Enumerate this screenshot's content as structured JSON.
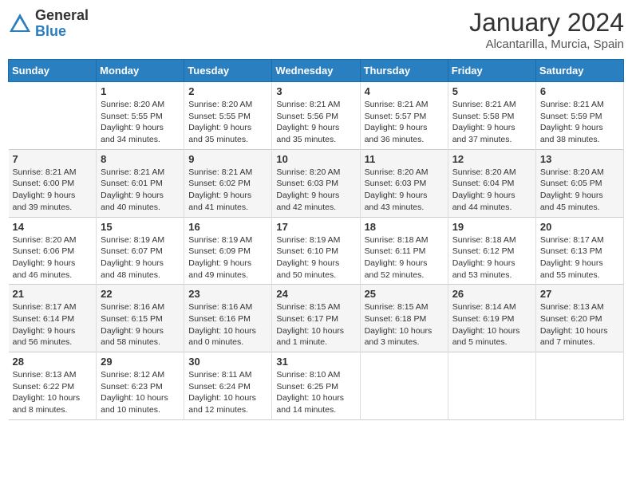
{
  "header": {
    "logo_general": "General",
    "logo_blue": "Blue",
    "month_title": "January 2024",
    "subtitle": "Alcantarilla, Murcia, Spain"
  },
  "days_of_week": [
    "Sunday",
    "Monday",
    "Tuesday",
    "Wednesday",
    "Thursday",
    "Friday",
    "Saturday"
  ],
  "weeks": [
    [
      {
        "day": "",
        "info": ""
      },
      {
        "day": "1",
        "info": "Sunrise: 8:20 AM\nSunset: 5:55 PM\nDaylight: 9 hours\nand 34 minutes."
      },
      {
        "day": "2",
        "info": "Sunrise: 8:20 AM\nSunset: 5:55 PM\nDaylight: 9 hours\nand 35 minutes."
      },
      {
        "day": "3",
        "info": "Sunrise: 8:21 AM\nSunset: 5:56 PM\nDaylight: 9 hours\nand 35 minutes."
      },
      {
        "day": "4",
        "info": "Sunrise: 8:21 AM\nSunset: 5:57 PM\nDaylight: 9 hours\nand 36 minutes."
      },
      {
        "day": "5",
        "info": "Sunrise: 8:21 AM\nSunset: 5:58 PM\nDaylight: 9 hours\nand 37 minutes."
      },
      {
        "day": "6",
        "info": "Sunrise: 8:21 AM\nSunset: 5:59 PM\nDaylight: 9 hours\nand 38 minutes."
      }
    ],
    [
      {
        "day": "7",
        "info": "Sunrise: 8:21 AM\nSunset: 6:00 PM\nDaylight: 9 hours\nand 39 minutes."
      },
      {
        "day": "8",
        "info": "Sunrise: 8:21 AM\nSunset: 6:01 PM\nDaylight: 9 hours\nand 40 minutes."
      },
      {
        "day": "9",
        "info": "Sunrise: 8:21 AM\nSunset: 6:02 PM\nDaylight: 9 hours\nand 41 minutes."
      },
      {
        "day": "10",
        "info": "Sunrise: 8:20 AM\nSunset: 6:03 PM\nDaylight: 9 hours\nand 42 minutes."
      },
      {
        "day": "11",
        "info": "Sunrise: 8:20 AM\nSunset: 6:03 PM\nDaylight: 9 hours\nand 43 minutes."
      },
      {
        "day": "12",
        "info": "Sunrise: 8:20 AM\nSunset: 6:04 PM\nDaylight: 9 hours\nand 44 minutes."
      },
      {
        "day": "13",
        "info": "Sunrise: 8:20 AM\nSunset: 6:05 PM\nDaylight: 9 hours\nand 45 minutes."
      }
    ],
    [
      {
        "day": "14",
        "info": "Sunrise: 8:20 AM\nSunset: 6:06 PM\nDaylight: 9 hours\nand 46 minutes."
      },
      {
        "day": "15",
        "info": "Sunrise: 8:19 AM\nSunset: 6:07 PM\nDaylight: 9 hours\nand 48 minutes."
      },
      {
        "day": "16",
        "info": "Sunrise: 8:19 AM\nSunset: 6:09 PM\nDaylight: 9 hours\nand 49 minutes."
      },
      {
        "day": "17",
        "info": "Sunrise: 8:19 AM\nSunset: 6:10 PM\nDaylight: 9 hours\nand 50 minutes."
      },
      {
        "day": "18",
        "info": "Sunrise: 8:18 AM\nSunset: 6:11 PM\nDaylight: 9 hours\nand 52 minutes."
      },
      {
        "day": "19",
        "info": "Sunrise: 8:18 AM\nSunset: 6:12 PM\nDaylight: 9 hours\nand 53 minutes."
      },
      {
        "day": "20",
        "info": "Sunrise: 8:17 AM\nSunset: 6:13 PM\nDaylight: 9 hours\nand 55 minutes."
      }
    ],
    [
      {
        "day": "21",
        "info": "Sunrise: 8:17 AM\nSunset: 6:14 PM\nDaylight: 9 hours\nand 56 minutes."
      },
      {
        "day": "22",
        "info": "Sunrise: 8:16 AM\nSunset: 6:15 PM\nDaylight: 9 hours\nand 58 minutes."
      },
      {
        "day": "23",
        "info": "Sunrise: 8:16 AM\nSunset: 6:16 PM\nDaylight: 10 hours\nand 0 minutes."
      },
      {
        "day": "24",
        "info": "Sunrise: 8:15 AM\nSunset: 6:17 PM\nDaylight: 10 hours\nand 1 minute."
      },
      {
        "day": "25",
        "info": "Sunrise: 8:15 AM\nSunset: 6:18 PM\nDaylight: 10 hours\nand 3 minutes."
      },
      {
        "day": "26",
        "info": "Sunrise: 8:14 AM\nSunset: 6:19 PM\nDaylight: 10 hours\nand 5 minutes."
      },
      {
        "day": "27",
        "info": "Sunrise: 8:13 AM\nSunset: 6:20 PM\nDaylight: 10 hours\nand 7 minutes."
      }
    ],
    [
      {
        "day": "28",
        "info": "Sunrise: 8:13 AM\nSunset: 6:22 PM\nDaylight: 10 hours\nand 8 minutes."
      },
      {
        "day": "29",
        "info": "Sunrise: 8:12 AM\nSunset: 6:23 PM\nDaylight: 10 hours\nand 10 minutes."
      },
      {
        "day": "30",
        "info": "Sunrise: 8:11 AM\nSunset: 6:24 PM\nDaylight: 10 hours\nand 12 minutes."
      },
      {
        "day": "31",
        "info": "Sunrise: 8:10 AM\nSunset: 6:25 PM\nDaylight: 10 hours\nand 14 minutes."
      },
      {
        "day": "",
        "info": ""
      },
      {
        "day": "",
        "info": ""
      },
      {
        "day": "",
        "info": ""
      }
    ]
  ]
}
